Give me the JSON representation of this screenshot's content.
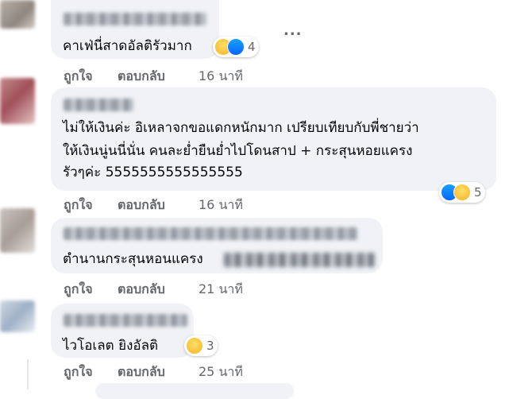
{
  "comments": [
    {
      "text_lines": [
        "คาเฟ่นี่สาดอัลติรัวมาก"
      ],
      "like_label": "ถูกใจ",
      "reply_label": "ตอบกลับ",
      "time": "16 นาที",
      "reaction_count": "4",
      "reaction_icons": [
        "haha-icon",
        "like-icon"
      ]
    },
    {
      "text_lines": [
        "ไม่ให้เงินค่ะ อิเหลาจกขอแดกหนักมาก เปรียบเทียบกับพี่ชายว่า",
        "ให้เงินนู่นนี่นั่น คนละย่ำยืนย่ำไปโดนสาป + กระสุนหอยแครง",
        "รัวๆค่ะ 5555555555555555"
      ],
      "like_label": "ถูกใจ",
      "reply_label": "ตอบกลับ",
      "time": "16 นาที",
      "reaction_count": "5",
      "reaction_icons": [
        "like-icon",
        "haha-icon"
      ]
    },
    {
      "text_lines": [
        "ตำนานกระสุนหอนแครง"
      ],
      "like_label": "ถูกใจ",
      "reply_label": "ตอบกลับ",
      "time": "21 นาที"
    },
    {
      "text_lines": [
        "ไวโอเลต ยิงอัลติ"
      ],
      "like_label": "ถูกใจ",
      "reply_label": "ตอบกลับ",
      "time": "25 นาที",
      "reaction_count": "3",
      "reaction_icons": [
        "haha-icon"
      ]
    }
  ],
  "more_options": "...",
  "colors": {
    "bubble": "#f0f2f5",
    "secondary_text": "#65676b",
    "like_blue": "#0866ff",
    "haha_yellow": "#f7b125"
  }
}
